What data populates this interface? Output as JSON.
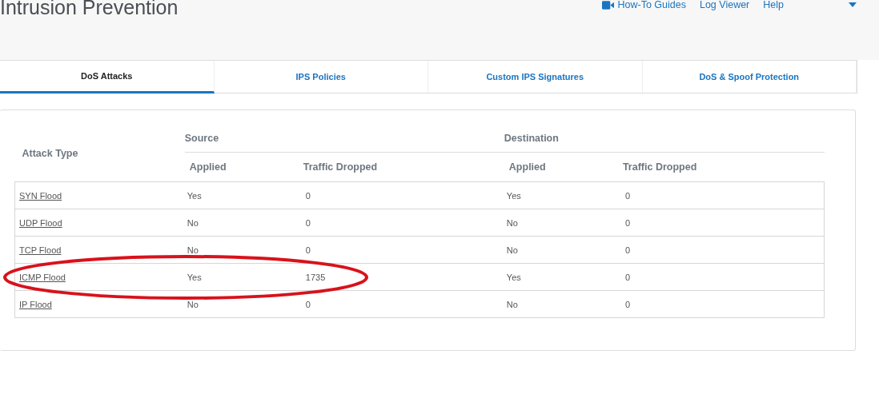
{
  "page_title": "Intrusion Prevention",
  "header_links": [
    {
      "label": "How-To Guides",
      "kind": "video"
    },
    {
      "label": "Log Viewer",
      "kind": "plain"
    },
    {
      "label": "Help",
      "kind": "plain"
    },
    {
      "kind": "user"
    }
  ],
  "tabs": [
    {
      "label": "DoS Attacks",
      "selected": true
    },
    {
      "label": "IPS Policies",
      "selected": false
    },
    {
      "label": "Custom IPS Signatures",
      "selected": false
    },
    {
      "label": "DoS & Spoof Protection",
      "selected": false
    }
  ],
  "table": {
    "attack_type_heading": "Attack Type",
    "groups": [
      {
        "label": "Source",
        "columns": [
          "Applied",
          "Traffic Dropped"
        ]
      },
      {
        "label": "Destination",
        "columns": [
          "Applied",
          "Traffic Dropped"
        ]
      }
    ],
    "rows": [
      {
        "attack": "SYN Flood",
        "values": [
          "Yes",
          "0",
          "Yes",
          "0"
        ]
      },
      {
        "attack": "UDP Flood",
        "values": [
          "No",
          "0",
          "No",
          "0"
        ]
      },
      {
        "attack": "TCP Flood",
        "values": [
          "No",
          "0",
          "No",
          "0"
        ]
      },
      {
        "attack": "ICMP Flood",
        "values": [
          "Yes",
          "1735",
          "Yes",
          "0"
        ]
      },
      {
        "attack": "IP Flood",
        "values": [
          "No",
          "0",
          "No",
          "0"
        ]
      }
    ]
  }
}
